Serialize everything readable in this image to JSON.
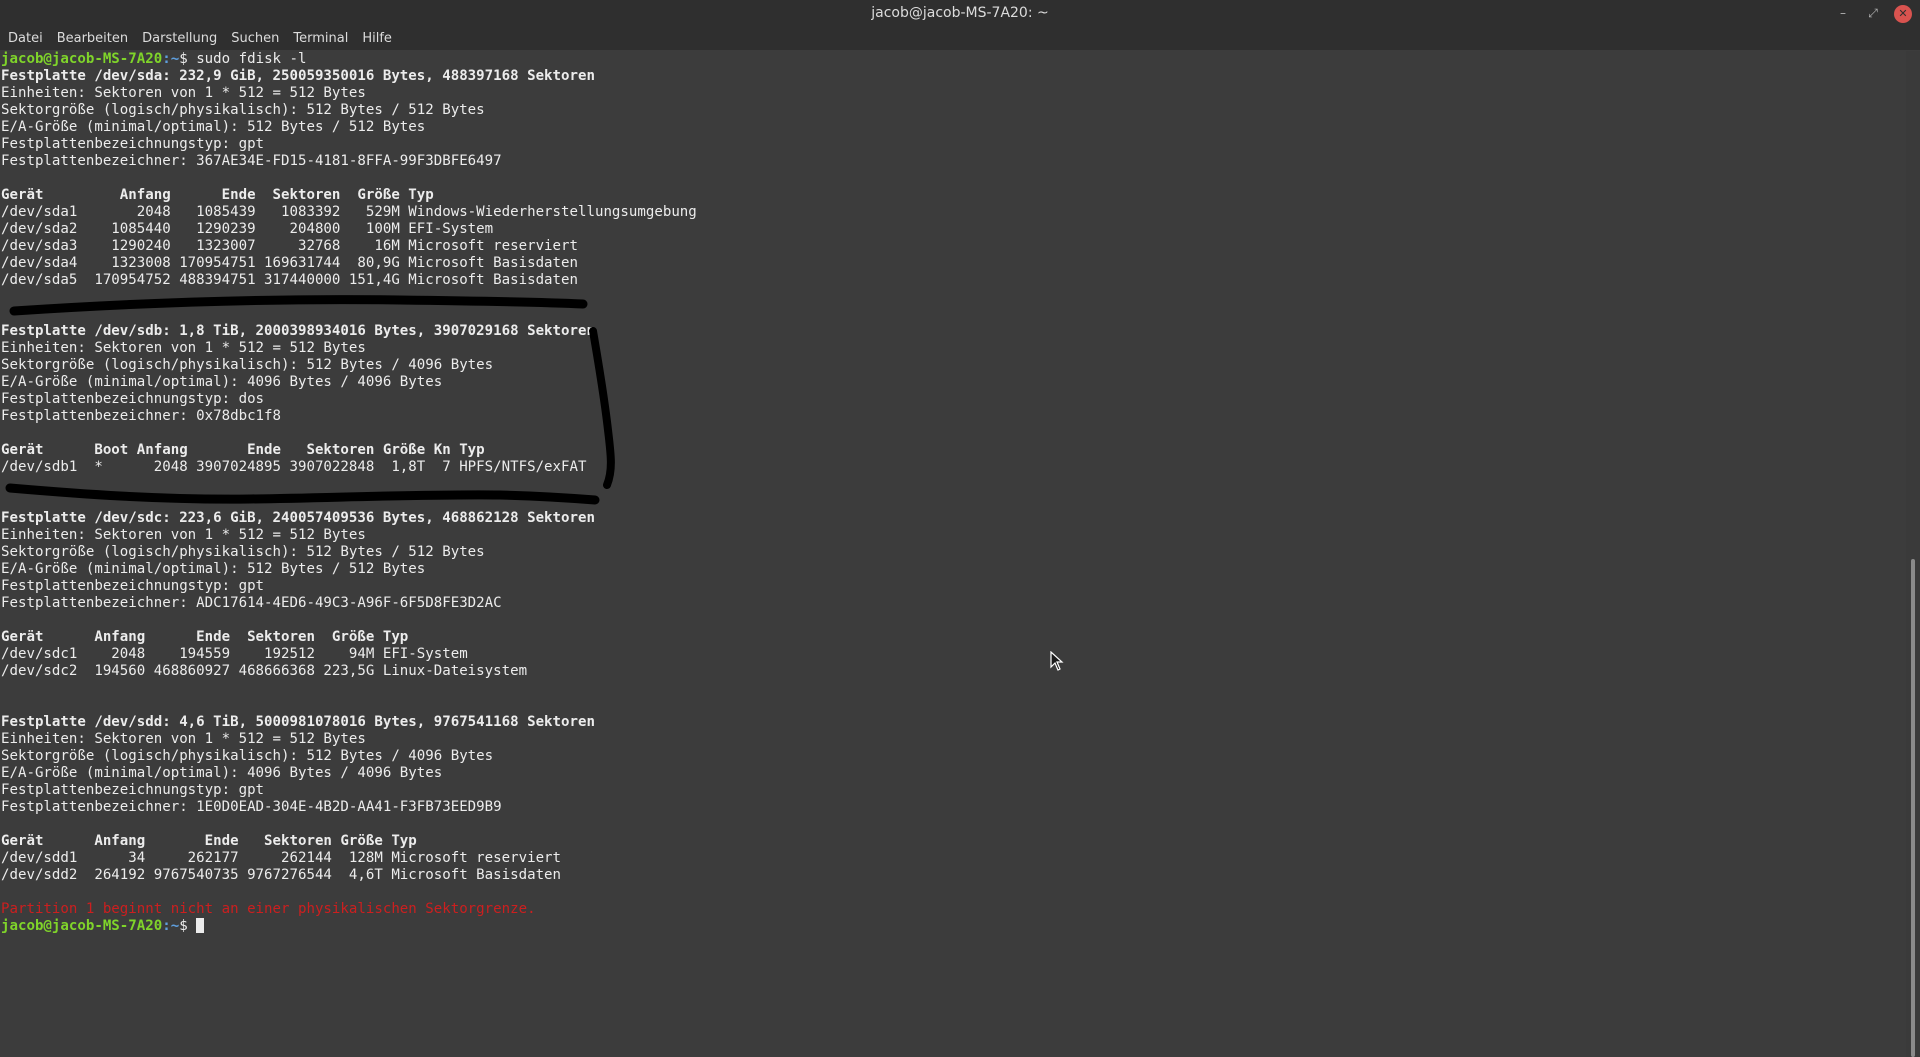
{
  "window": {
    "title": "jacob@jacob-MS-7A20: ~"
  },
  "controls": {
    "minimize_icon": "minimize-icon",
    "maximize_icon": "maximize-icon",
    "close_icon": "close-icon"
  },
  "menu": {
    "items": [
      "Datei",
      "Bearbeiten",
      "Darstellung",
      "Suchen",
      "Terminal",
      "Hilfe"
    ]
  },
  "terminal": {
    "prompt_user": "jacob@jacob-MS-7A20",
    "prompt_path": ":~",
    "prompt_symbol": "$ ",
    "command": "sudo fdisk -l",
    "lines": [
      {
        "text": "Festplatte /dev/sda: 232,9 GiB, 250059350016 Bytes, 488397168 Sektoren",
        "style": "bold"
      },
      {
        "text": "Einheiten: Sektoren von 1 * 512 = 512 Bytes",
        "style": "normal"
      },
      {
        "text": "Sektorgröße (logisch/physikalisch): 512 Bytes / 512 Bytes",
        "style": "normal"
      },
      {
        "text": "E/A-Größe (minimal/optimal): 512 Bytes / 512 Bytes",
        "style": "normal"
      },
      {
        "text": "Festplattenbezeichnungstyp: gpt",
        "style": "normal"
      },
      {
        "text": "Festplattenbezeichner: 367AE34E-FD15-4181-8FFA-99F3DBFE6497",
        "style": "normal"
      },
      {
        "text": "",
        "style": "normal"
      },
      {
        "text": "Gerät         Anfang      Ende  Sektoren  Größe Typ",
        "style": "bold"
      },
      {
        "text": "/dev/sda1       2048   1085439   1083392   529M Windows-Wiederherstellungsumgebung",
        "style": "normal"
      },
      {
        "text": "/dev/sda2    1085440   1290239    204800   100M EFI-System",
        "style": "normal"
      },
      {
        "text": "/dev/sda3    1290240   1323007     32768    16M Microsoft reserviert",
        "style": "normal"
      },
      {
        "text": "/dev/sda4    1323008 170954751 169631744  80,9G Microsoft Basisdaten",
        "style": "normal"
      },
      {
        "text": "/dev/sda5  170954752 488394751 317440000 151,4G Microsoft Basisdaten",
        "style": "normal"
      },
      {
        "text": "",
        "style": "normal"
      },
      {
        "text": "",
        "style": "normal"
      },
      {
        "text": "Festplatte /dev/sdb: 1,8 TiB, 2000398934016 Bytes, 3907029168 Sektoren",
        "style": "bold"
      },
      {
        "text": "Einheiten: Sektoren von 1 * 512 = 512 Bytes",
        "style": "normal"
      },
      {
        "text": "Sektorgröße (logisch/physikalisch): 512 Bytes / 4096 Bytes",
        "style": "normal"
      },
      {
        "text": "E/A-Größe (minimal/optimal): 4096 Bytes / 4096 Bytes",
        "style": "normal"
      },
      {
        "text": "Festplattenbezeichnungstyp: dos",
        "style": "normal"
      },
      {
        "text": "Festplattenbezeichner: 0x78dbc1f8",
        "style": "normal"
      },
      {
        "text": "",
        "style": "normal"
      },
      {
        "text": "Gerät      Boot Anfang       Ende   Sektoren Größe Kn Typ",
        "style": "bold"
      },
      {
        "text": "/dev/sdb1  *      2048 3907024895 3907022848  1,8T  7 HPFS/NTFS/exFAT",
        "style": "normal"
      },
      {
        "text": "",
        "style": "normal"
      },
      {
        "text": "",
        "style": "normal"
      },
      {
        "text": "Festplatte /dev/sdc: 223,6 GiB, 240057409536 Bytes, 468862128 Sektoren",
        "style": "bold"
      },
      {
        "text": "Einheiten: Sektoren von 1 * 512 = 512 Bytes",
        "style": "normal"
      },
      {
        "text": "Sektorgröße (logisch/physikalisch): 512 Bytes / 512 Bytes",
        "style": "normal"
      },
      {
        "text": "E/A-Größe (minimal/optimal): 512 Bytes / 512 Bytes",
        "style": "normal"
      },
      {
        "text": "Festplattenbezeichnungstyp: gpt",
        "style": "normal"
      },
      {
        "text": "Festplattenbezeichner: ADC17614-4ED6-49C3-A96F-6F5D8FE3D2AC",
        "style": "normal"
      },
      {
        "text": "",
        "style": "normal"
      },
      {
        "text": "Gerät      Anfang      Ende  Sektoren  Größe Typ",
        "style": "bold"
      },
      {
        "text": "/dev/sdc1    2048    194559    192512    94M EFI-System",
        "style": "normal"
      },
      {
        "text": "/dev/sdc2  194560 468860927 468666368 223,5G Linux-Dateisystem",
        "style": "normal"
      },
      {
        "text": "",
        "style": "normal"
      },
      {
        "text": "",
        "style": "normal"
      },
      {
        "text": "Festplatte /dev/sdd: 4,6 TiB, 5000981078016 Bytes, 9767541168 Sektoren",
        "style": "bold"
      },
      {
        "text": "Einheiten: Sektoren von 1 * 512 = 512 Bytes",
        "style": "normal"
      },
      {
        "text": "Sektorgröße (logisch/physikalisch): 512 Bytes / 4096 Bytes",
        "style": "normal"
      },
      {
        "text": "E/A-Größe (minimal/optimal): 4096 Bytes / 4096 Bytes",
        "style": "normal"
      },
      {
        "text": "Festplattenbezeichnungstyp: gpt",
        "style": "normal"
      },
      {
        "text": "Festplattenbezeichner: 1E0D0EAD-304E-4B2D-AA41-F3FB73EED9B9",
        "style": "normal"
      },
      {
        "text": "",
        "style": "normal"
      },
      {
        "text": "Gerät      Anfang       Ende   Sektoren Größe Typ",
        "style": "bold"
      },
      {
        "text": "/dev/sdd1      34     262177     262144  128M Microsoft reserviert",
        "style": "normal"
      },
      {
        "text": "/dev/sdd2  264192 9767540735 9767276544  4,6T Microsoft Basisdaten",
        "style": "normal"
      },
      {
        "text": "",
        "style": "normal"
      },
      {
        "text": "Partition 1 beginnt nicht an einer physikalischen Sektorgrenze.",
        "style": "error"
      }
    ]
  },
  "colors": {
    "background": "#3c3c3c",
    "text": "#ececec",
    "prompt_user": "#7fd42a",
    "prompt_path": "#5f9fde",
    "error": "#cc1f1f",
    "annotation_stroke": "#000000"
  },
  "icons": {
    "mouse_pointer": "mouse-pointer-icon",
    "text_cursor": "text-cursor-icon"
  }
}
